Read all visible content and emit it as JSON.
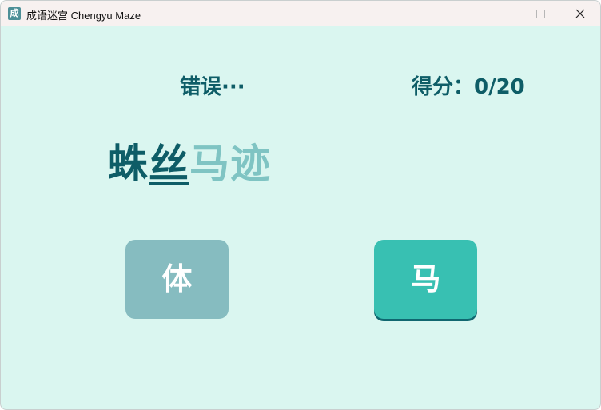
{
  "window": {
    "title": "成语迷宫 Chengyu Maze",
    "icon_char": "成",
    "controls": [
      "minimize",
      "maximize",
      "close"
    ]
  },
  "game": {
    "status": "错误···",
    "score_text": "得分：0/20",
    "score": 0,
    "total": 20,
    "idiom": [
      {
        "char": "蛛",
        "state": "done"
      },
      {
        "char": "丝",
        "state": "current"
      },
      {
        "char": "马",
        "state": "pending"
      },
      {
        "char": "迹",
        "state": "pending"
      }
    ],
    "choices": [
      {
        "label": "体",
        "color": "#86bcc0"
      },
      {
        "label": "马",
        "color": "#38c0b2"
      }
    ]
  },
  "colors": {
    "background": "#daf6f0",
    "primary_text": "#0e5d67",
    "pending_text": "#7fc4c3"
  }
}
